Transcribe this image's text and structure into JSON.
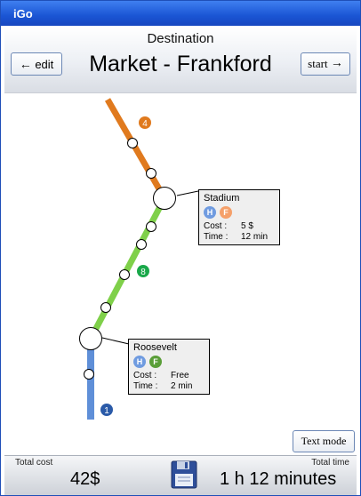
{
  "window": {
    "title": "iGo"
  },
  "header": {
    "label": "Destination",
    "destination": "Market - Frankford",
    "edit_label": "edit",
    "start_label": "start"
  },
  "route": {
    "lines": [
      {
        "badge": "4",
        "color": "#e07a1e"
      },
      {
        "badge": "8",
        "color": "#7fd04a"
      },
      {
        "badge": "1",
        "color": "#5f8fd8"
      }
    ],
    "stops": [
      {
        "name": "Stadium",
        "icons": [
          {
            "letter": "H",
            "color": "#6f9be0"
          },
          {
            "letter": "F",
            "color": "#f5a06a"
          }
        ],
        "cost_label": "Cost :",
        "cost": "5 $",
        "time_label": "Time :",
        "time": "12 min"
      },
      {
        "name": "Roosevelt",
        "icons": [
          {
            "letter": "H",
            "color": "#6f9be0"
          },
          {
            "letter": "F",
            "color": "#5a9e38"
          }
        ],
        "cost_label": "Cost :",
        "cost": "Free",
        "time_label": "Time :",
        "time": "2 min"
      }
    ]
  },
  "text_mode_label": "Text mode",
  "footer": {
    "total_cost_label": "Total cost",
    "total_cost": "42$",
    "total_time_label": "Total time",
    "total_time": "1 h 12 minutes"
  }
}
